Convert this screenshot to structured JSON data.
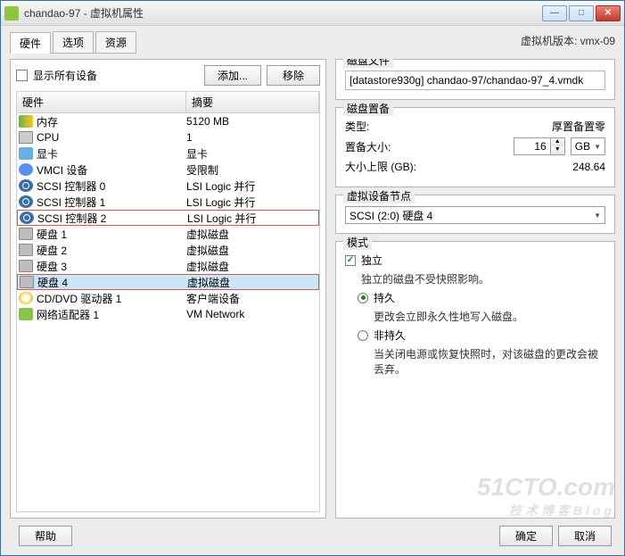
{
  "title": "chandao-97 - 虚拟机属性",
  "winbtns": {
    "min": "—",
    "max": "□",
    "close": "✕"
  },
  "vm_version_label": "虚拟机版本: vmx-09",
  "tabs": [
    "硬件",
    "选项",
    "资源"
  ],
  "toolbar": {
    "show_all_devices": "显示所有设备",
    "add_label": "添加...",
    "remove_label": "移除"
  },
  "columns": {
    "hardware": "硬件",
    "summary": "摘要"
  },
  "rows": [
    {
      "icon": "mem",
      "name": "内存",
      "summary": "5120 MB"
    },
    {
      "icon": "cpu",
      "name": "CPU",
      "summary": "1"
    },
    {
      "icon": "disp",
      "name": "显卡",
      "summary": "显卡"
    },
    {
      "icon": "vmci",
      "name": "VMCI 设备",
      "summary": "受限制"
    },
    {
      "icon": "scsi",
      "name": "SCSI 控制器 0",
      "summary": "LSI Logic 并行"
    },
    {
      "icon": "scsi",
      "name": "SCSI 控制器 1",
      "summary": "LSI Logic 并行"
    },
    {
      "icon": "scsi",
      "name": "SCSI 控制器 2",
      "summary": "LSI Logic 并行",
      "marked": true
    },
    {
      "icon": "disk",
      "name": "硬盘 1",
      "summary": "虚拟磁盘"
    },
    {
      "icon": "disk",
      "name": "硬盘 2",
      "summary": "虚拟磁盘"
    },
    {
      "icon": "disk",
      "name": "硬盘 3",
      "summary": "虚拟磁盘"
    },
    {
      "icon": "disk",
      "name": "硬盘 4",
      "summary": "虚拟磁盘",
      "selected": true,
      "marked": true
    },
    {
      "icon": "cd",
      "name": "CD/DVD 驱动器 1",
      "summary": "客户端设备"
    },
    {
      "icon": "net",
      "name": "网络适配器 1",
      "summary": "VM Network"
    }
  ],
  "diskfile": {
    "legend": "磁盘文件",
    "value": "[datastore930g] chandao-97/chandao-97_4.vmdk"
  },
  "provision": {
    "legend": "磁盘置备",
    "type_label": "类型:",
    "type_value": "厚置备置零",
    "size_label": "置备大小:",
    "size_value": "16",
    "size_unit": "GB",
    "max_label": "大小上限 (GB):",
    "max_value": "248.64"
  },
  "vnode": {
    "legend": "虚拟设备节点",
    "value": "SCSI (2:0) 硬盘 4"
  },
  "mode": {
    "legend": "模式",
    "independent_label": "独立",
    "independent_desc": "独立的磁盘不受快照影响。",
    "persistent_label": "持久",
    "persistent_desc": "更改会立即永久性地写入磁盘。",
    "nonpersistent_label": "非持久",
    "nonpersistent_desc": "当关闭电源或恢复快照时，对该磁盘的更改会被丢弃。"
  },
  "footer": {
    "help": "帮助",
    "ok": "确定",
    "cancel": "取消"
  },
  "watermark": {
    "main": "51CTO.com",
    "sub": "技术博客Blog"
  }
}
